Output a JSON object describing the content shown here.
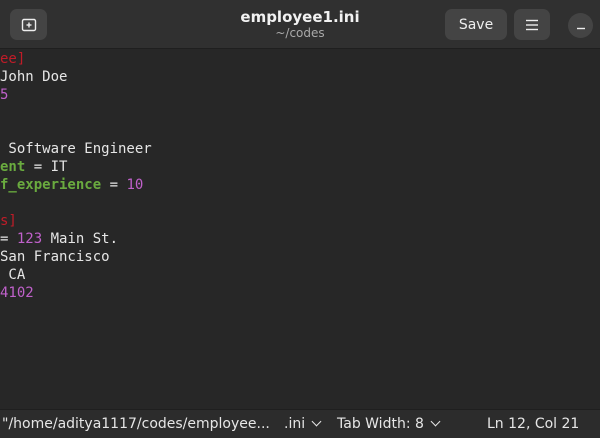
{
  "window": {
    "title": "employee1.ini",
    "subtitle": "~/codes",
    "save_label": "Save",
    "new_tab_icon": "new-tab-icon",
    "menu_icon": "hamburger-menu-icon",
    "minimize_icon": "minimize-icon"
  },
  "editor": {
    "lines": [
      [
        {
          "t": "ee]",
          "c": "sec"
        }
      ],
      [
        {
          "t": "John Doe",
          "c": "txt"
        }
      ],
      [
        {
          "t": "5",
          "c": "num"
        }
      ],
      [],
      [],
      [
        {
          "t": " Software Engineer",
          "c": "txt"
        }
      ],
      [
        {
          "t": "ent",
          "c": "key"
        },
        {
          "t": " = IT",
          "c": "txt"
        }
      ],
      [
        {
          "t": "f_experience",
          "c": "key"
        },
        {
          "t": " = ",
          "c": "txt"
        },
        {
          "t": "10",
          "c": "num"
        }
      ],
      [],
      [
        {
          "t": "s]",
          "c": "sec"
        }
      ],
      [
        {
          "t": "= ",
          "c": "txt"
        },
        {
          "t": "123",
          "c": "num"
        },
        {
          "t": " Main St.",
          "c": "txt"
        }
      ],
      [
        {
          "t": "San Francisco",
          "c": "txt"
        }
      ],
      [
        {
          "t": " CA",
          "c": "txt"
        }
      ],
      [
        {
          "t": "4102",
          "c": "num"
        }
      ]
    ]
  },
  "statusbar": {
    "path": "\"/home/aditya1117/codes/employee...",
    "language": ".ini",
    "tab_width": "Tab Width: 8",
    "position": "Ln 12, Col 21"
  },
  "colors": {
    "section": "#c01c28",
    "key": "#6aab3f",
    "number": "#c061cb",
    "text": "#e6e6e6",
    "background": "#272727"
  }
}
